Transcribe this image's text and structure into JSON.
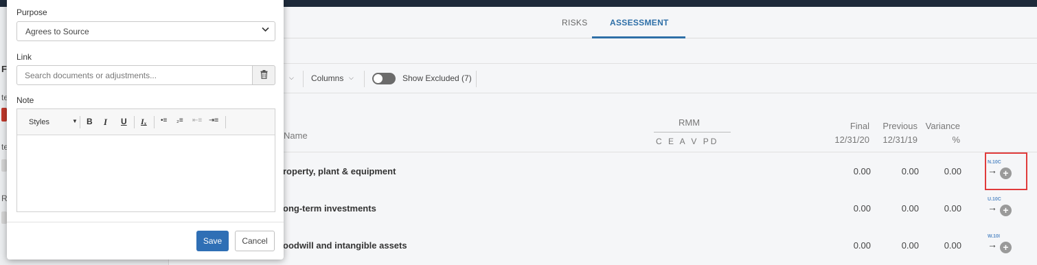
{
  "background": {
    "left_panel": {
      "heading_fragment": "F",
      "label_1": "te",
      "label_2": "te",
      "label_3": "R"
    },
    "tabs": [
      {
        "label": "RISKS"
      },
      {
        "label": "ASSESSMENT",
        "active": true
      }
    ],
    "toolbar": {
      "columns_label": "Columns",
      "show_excluded_label": "Show Excluded (7)"
    },
    "table": {
      "headers": {
        "name": "Name",
        "rmm": "RMM",
        "rmm_sub": "C E A V PD",
        "final": "Final",
        "final_date": "12/31/20",
        "previous": "Previous",
        "previous_date": "12/31/19",
        "variance": "Variance",
        "variance_unit": "%"
      },
      "rows": [
        {
          "name": "roperty, plant & equipment",
          "final": "0.00",
          "previous": "0.00",
          "variance": "0.00",
          "ref_code": "N.10C"
        },
        {
          "name": "ong-term investments",
          "final": "0.00",
          "previous": "0.00",
          "variance": "0.00",
          "ref_code": "U.10C"
        },
        {
          "name": "oodwill and intangible assets",
          "final": "0.00",
          "previous": "0.00",
          "variance": "0.00",
          "ref_code": "W.10I"
        }
      ]
    }
  },
  "modal": {
    "purpose_label": "Purpose",
    "purpose_value": "Agrees to Source",
    "link_label": "Link",
    "link_placeholder": "Search documents or adjustments...",
    "note_label": "Note",
    "editor_styles_label": "Styles",
    "save_label": "Save",
    "cancel_label": "Cancel"
  },
  "colors": {
    "accent": "#2e6fa7",
    "save_button": "#2f6fb5",
    "highlight": "#e03a3a"
  },
  "icons": [
    "chevron-down-icon",
    "trash-icon",
    "bold-icon",
    "italic-icon",
    "underline-icon",
    "remove-format-icon",
    "bulleted-list-icon",
    "numbered-list-icon",
    "outdent-icon",
    "indent-icon",
    "arrow-right-icon",
    "add-circle-icon"
  ]
}
